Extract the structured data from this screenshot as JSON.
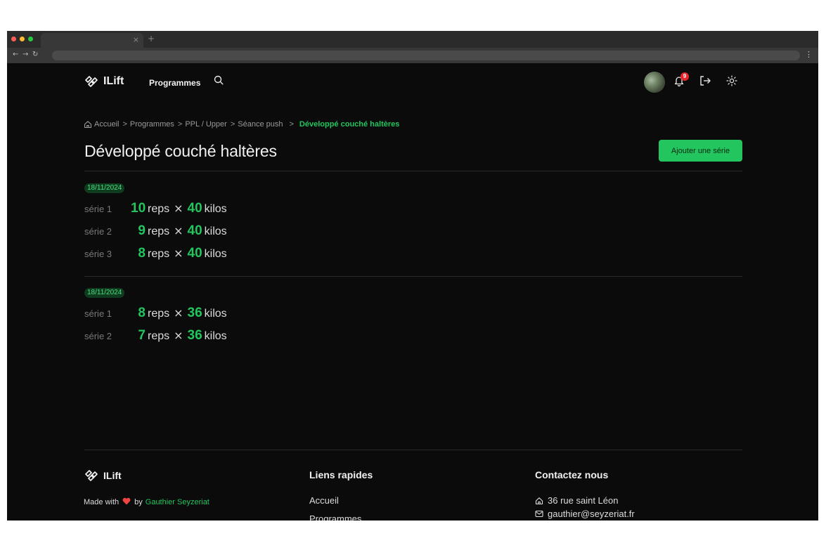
{
  "browser": {
    "traffic_lights": [
      "#ff5f57",
      "#febc2e",
      "#28c840"
    ],
    "tab_close_icon": "close-icon",
    "new_tab_icon": "plus-icon",
    "tab_close": "×",
    "new_tab": "+",
    "back": "←",
    "forward": "→",
    "reload": "↻",
    "menu": "⋮"
  },
  "brand": {
    "name": "ILift",
    "logo_icon": "chain-link-icon"
  },
  "nav": {
    "programmes": "Programmes",
    "search_icon": "search-icon",
    "bell_badge": "9",
    "logout_icon": "logout-icon",
    "theme_icon": "sun-icon"
  },
  "breadcrumb": {
    "separator": ">",
    "items": [
      "Accueil",
      "Programmes",
      "PPL / Upper",
      "Séance push"
    ],
    "current": "Développé couché haltères"
  },
  "page": {
    "title": "Développé couché haltères",
    "add_button": "Ajouter une série"
  },
  "units": {
    "reps": "reps",
    "times": "×",
    "kilos": "kilos"
  },
  "sessions": [
    {
      "date": "18/11/2024",
      "series": [
        {
          "label": "série 1",
          "reps": "10",
          "kilos": "40"
        },
        {
          "label": "série 2",
          "reps": "9",
          "kilos": "40"
        },
        {
          "label": "série 3",
          "reps": "8",
          "kilos": "40"
        }
      ]
    },
    {
      "date": "18/11/2024",
      "series": [
        {
          "label": "série 1",
          "reps": "8",
          "kilos": "36"
        },
        {
          "label": "série 2",
          "reps": "7",
          "kilos": "36"
        }
      ]
    }
  ],
  "footer": {
    "brand": "ILift",
    "made_with": "Made with",
    "by": "by",
    "author": "Gauthier Seyzeriat",
    "quick_links_title": "Liens rapides",
    "quick_links": [
      "Accueil",
      "Programmes"
    ],
    "contact_title": "Contactez nous",
    "address": "36 rue saint Léon",
    "email": "gauthier@seyzeriat.fr"
  },
  "colors": {
    "accent": "#22c55e",
    "background": "#0b0b0b",
    "badge": "#e5252a"
  }
}
